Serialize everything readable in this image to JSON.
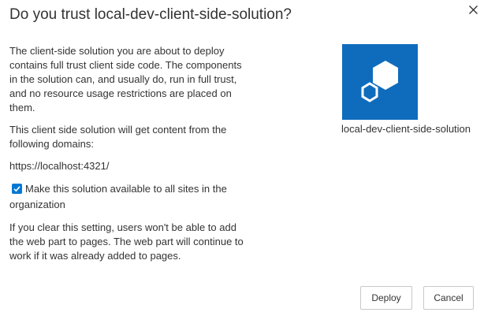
{
  "dialog": {
    "title": "Do you trust local-dev-client-side-solution?",
    "close_icon": "close-icon"
  },
  "body": {
    "paragraph1": "The client-side solution you are about to deploy contains full trust client side code. The components in the solution can, and usually do, run in full trust, and no resource usage restrictions are placed on them.",
    "paragraph2": "This client side solution will get content from the following domains:",
    "domain": "https://localhost:4321/",
    "checkbox_label": "Make this solution available to all sites in the organization",
    "checkbox_checked": true,
    "paragraph3": "If you clear this setting, users won't be able to add the web part to pages. The web part will continue to work if it was already added to pages."
  },
  "solution": {
    "name": "local-dev-client-side-solution",
    "icon": "cube-package-icon",
    "tile_color": "#0f6cbd"
  },
  "buttons": {
    "deploy_label": "Deploy",
    "cancel_label": "Cancel"
  },
  "colors": {
    "accent": "#0078d4",
    "text": "#333333"
  }
}
